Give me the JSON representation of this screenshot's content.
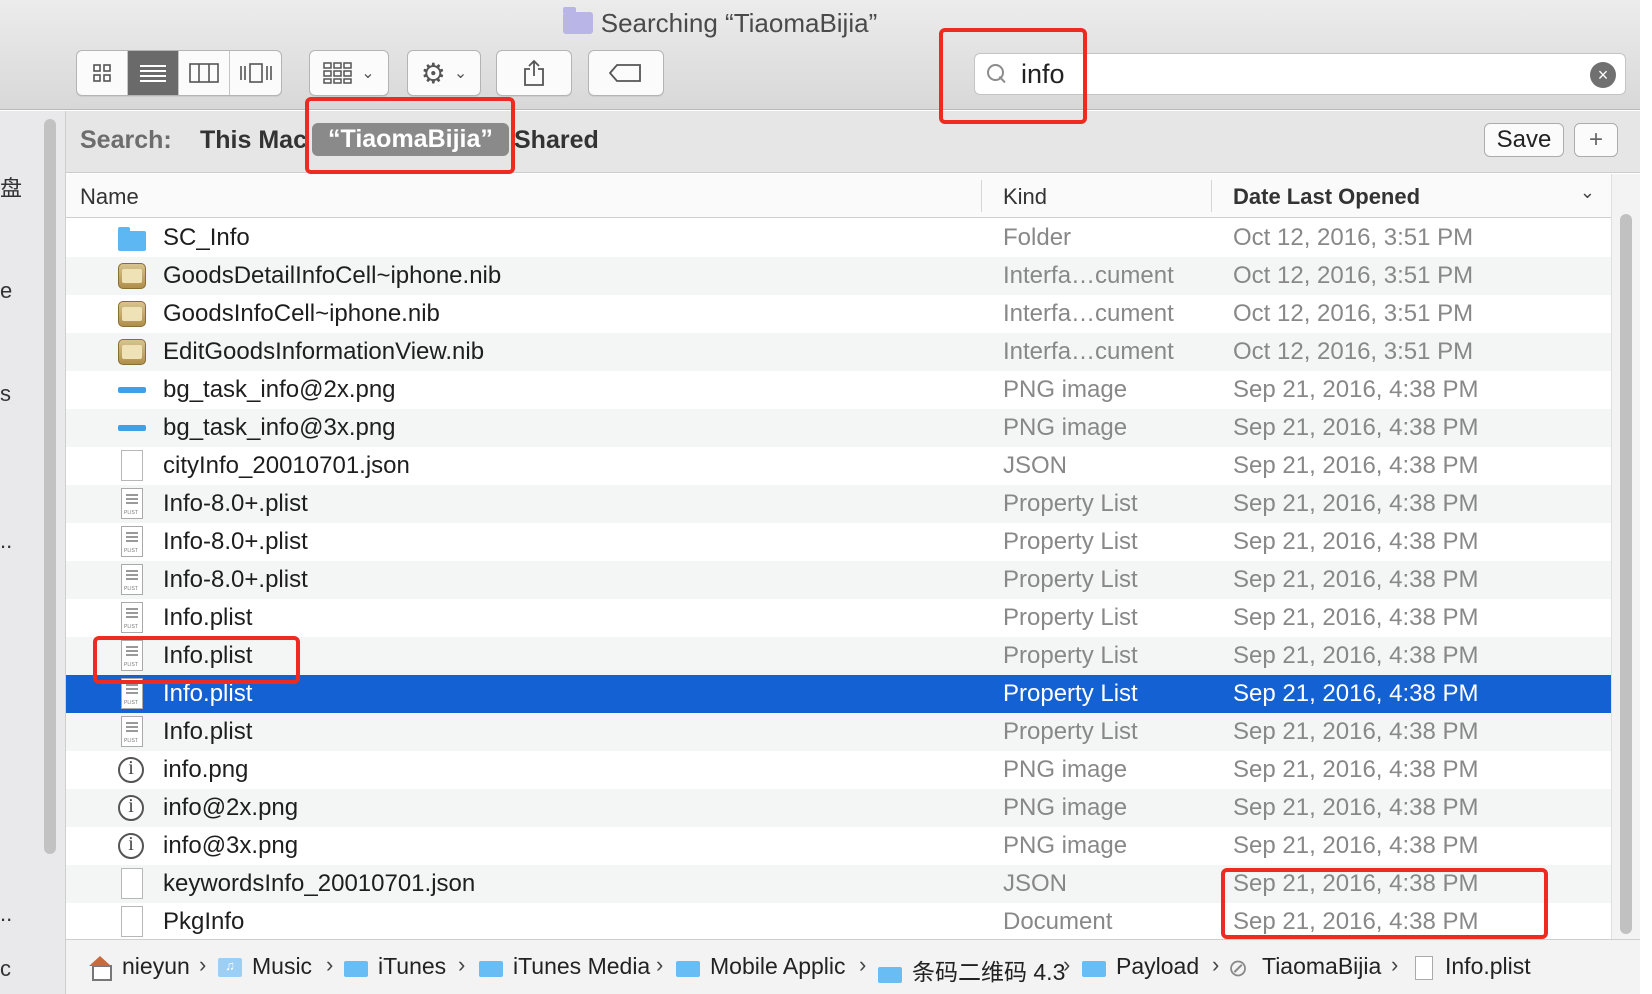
{
  "window": {
    "title": "Searching “TiaomaBijia”"
  },
  "toolbar": {
    "view_buttons": [
      {
        "icon": "icon-view-grid-icon",
        "active": false
      },
      {
        "icon": "list-view-icon",
        "active": true
      },
      {
        "icon": "column-view-icon",
        "active": false
      },
      {
        "icon": "cover-flow-icon",
        "active": false
      }
    ],
    "arrange_icon": "arrange-grid-icon",
    "action_icon": "gear-icon",
    "share_icon": "share-icon",
    "tag_icon": "tag-icon"
  },
  "search": {
    "value": "info",
    "clear_icon": "×"
  },
  "scope_bar": {
    "label": "Search:",
    "scopes": [
      "This Mac",
      "“TiaomaBijia”",
      "Shared"
    ],
    "selected_index": 1,
    "save_label": "Save",
    "add_label": "+"
  },
  "sidebar_fragments": [
    "盘",
    "e",
    "s",
    "..",
    "..",
    "c"
  ],
  "columns": {
    "name": "Name",
    "kind": "Kind",
    "date": "Date Last Opened"
  },
  "files": [
    {
      "name": "SC_Info",
      "kind": "Folder",
      "date": "Oct 12, 2016, 3:51 PM",
      "icon": "folder"
    },
    {
      "name": "GoodsDetailInfoCell~iphone.nib",
      "kind": "Interfa…cument",
      "date": "Oct 12, 2016, 3:51 PM",
      "icon": "nib"
    },
    {
      "name": "GoodsInfoCell~iphone.nib",
      "kind": "Interfa…cument",
      "date": "Oct 12, 2016, 3:51 PM",
      "icon": "nib"
    },
    {
      "name": "EditGoodsInformationView.nib",
      "kind": "Interfa…cument",
      "date": "Oct 12, 2016, 3:51 PM",
      "icon": "nib"
    },
    {
      "name": "bg_task_info@2x.png",
      "kind": "PNG image",
      "date": "Sep 21, 2016, 4:38 PM",
      "icon": "png"
    },
    {
      "name": "bg_task_info@3x.png",
      "kind": "PNG image",
      "date": "Sep 21, 2016, 4:38 PM",
      "icon": "png"
    },
    {
      "name": "cityInfo_20010701.json",
      "kind": "JSON",
      "date": "Sep 21, 2016, 4:38 PM",
      "icon": "doc"
    },
    {
      "name": "Info-8.0+.plist",
      "kind": "Property List",
      "date": "Sep 21, 2016, 4:38 PM",
      "icon": "plist"
    },
    {
      "name": "Info-8.0+.plist",
      "kind": "Property List",
      "date": "Sep 21, 2016, 4:38 PM",
      "icon": "plist"
    },
    {
      "name": "Info-8.0+.plist",
      "kind": "Property List",
      "date": "Sep 21, 2016, 4:38 PM",
      "icon": "plist"
    },
    {
      "name": "Info.plist",
      "kind": "Property List",
      "date": "Sep 21, 2016, 4:38 PM",
      "icon": "plist"
    },
    {
      "name": "Info.plist",
      "kind": "Property List",
      "date": "Sep 21, 2016, 4:38 PM",
      "icon": "plist"
    },
    {
      "name": "Info.plist",
      "kind": "Property List",
      "date": "Sep 21, 2016, 4:38 PM",
      "icon": "plist",
      "selected": true
    },
    {
      "name": "Info.plist",
      "kind": "Property List",
      "date": "Sep 21, 2016, 4:38 PM",
      "icon": "plist"
    },
    {
      "name": "info.png",
      "kind": "PNG image",
      "date": "Sep 21, 2016, 4:38 PM",
      "icon": "info"
    },
    {
      "name": "info@2x.png",
      "kind": "PNG image",
      "date": "Sep 21, 2016, 4:38 PM",
      "icon": "info"
    },
    {
      "name": "info@3x.png",
      "kind": "PNG image",
      "date": "Sep 21, 2016, 4:38 PM",
      "icon": "info"
    },
    {
      "name": "keywordsInfo_20010701.json",
      "kind": "JSON",
      "date": "Sep 21, 2016, 4:38 PM",
      "icon": "doc"
    },
    {
      "name": "PkgInfo",
      "kind": "Document",
      "date": "Sep 21, 2016, 4:38 PM",
      "icon": "doc"
    }
  ],
  "path_bar": [
    {
      "label": "nieyun",
      "icon": "home"
    },
    {
      "label": "Music",
      "icon": "music"
    },
    {
      "label": "iTunes",
      "icon": "folder"
    },
    {
      "label": "iTunes Media",
      "icon": "folder"
    },
    {
      "label": "Mobile Applic",
      "icon": "folder"
    },
    {
      "label": "条码二维码 4.3",
      "icon": "folder"
    },
    {
      "label": "Payload",
      "icon": "folder"
    },
    {
      "label": "TiaomaBijia",
      "icon": "app"
    },
    {
      "label": "Info.plist",
      "icon": "plist"
    }
  ],
  "path_separator": "›",
  "colors": {
    "selection": "#1361d3",
    "annotation": "#ee2a21",
    "folder": "#5cb7f2"
  }
}
